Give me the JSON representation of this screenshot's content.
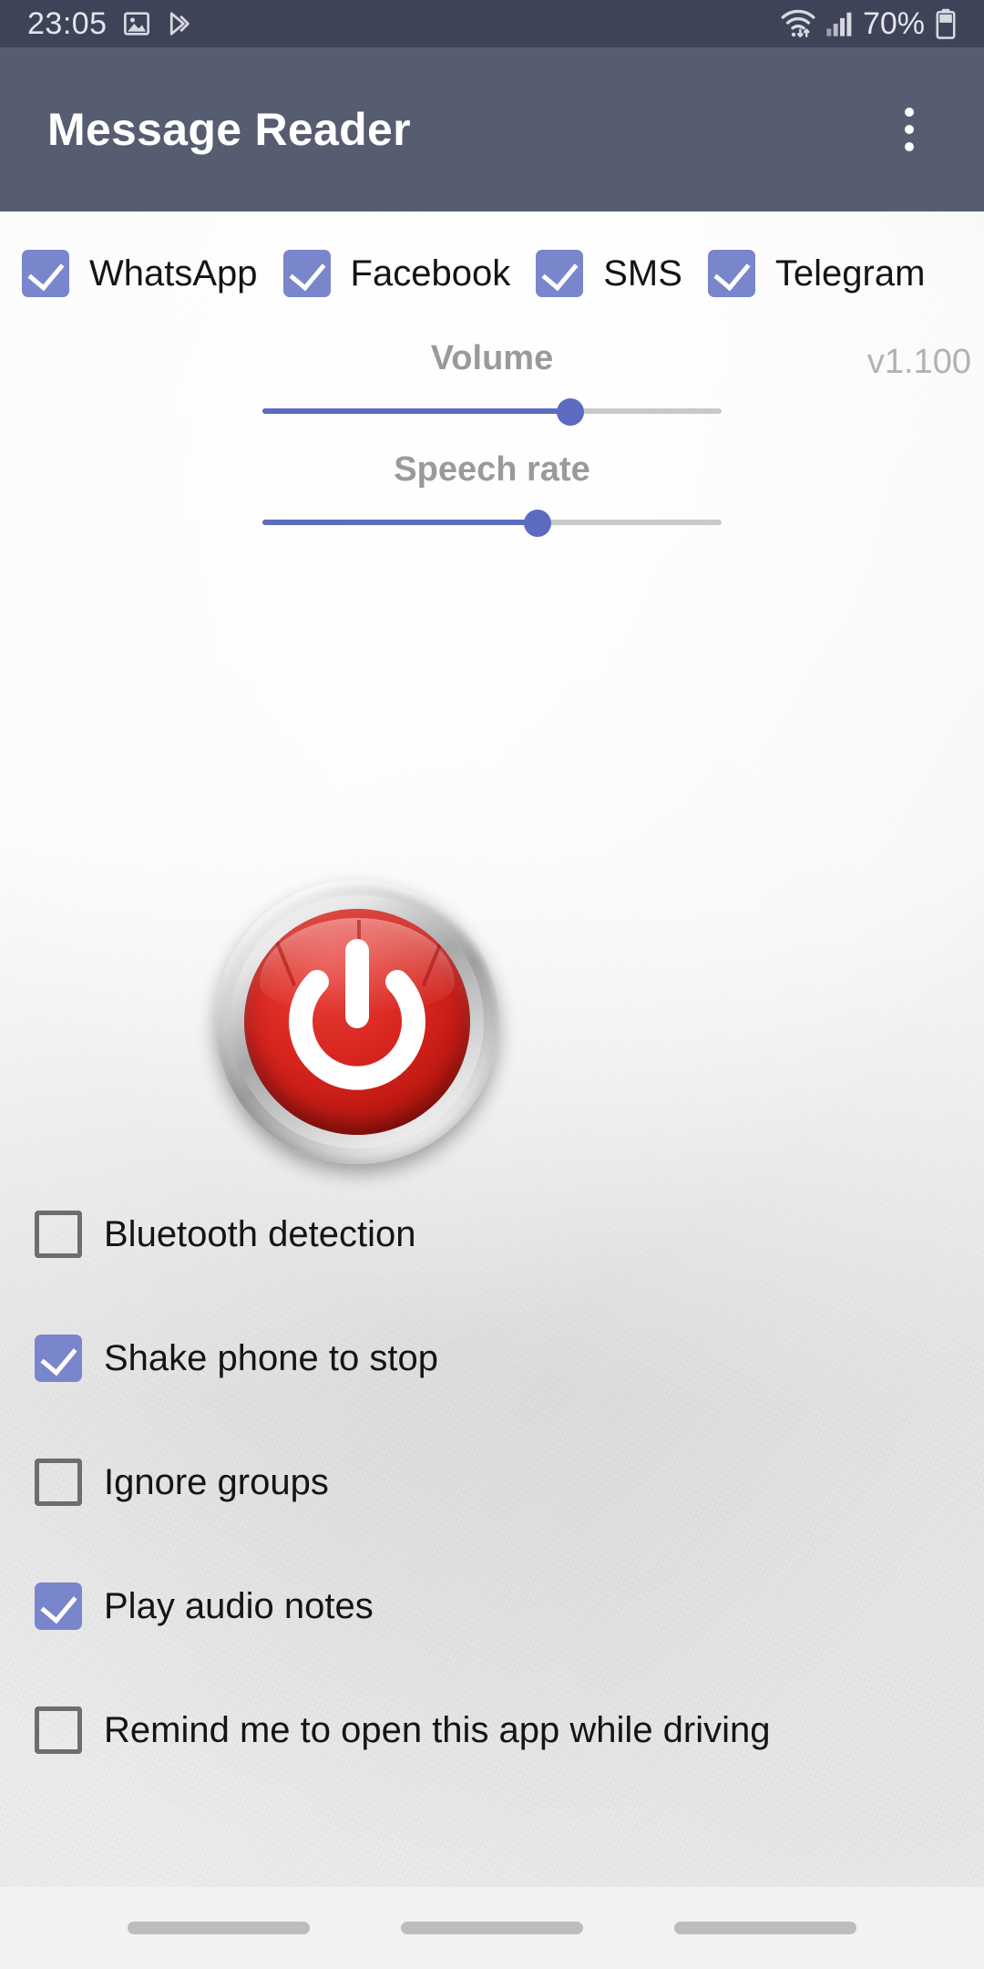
{
  "status_bar": {
    "time": "23:05",
    "battery_percent": "70%",
    "icons": [
      "image-icon",
      "play-triangle-icon",
      "wifi-icon",
      "signal-icon",
      "battery-icon"
    ],
    "background_color": "#3e4358"
  },
  "app_bar": {
    "title": "Message Reader",
    "overflow_menu": "overflow-menu-icon",
    "background_color": "#565d70"
  },
  "sources": {
    "items": [
      {
        "label": "WhatsApp",
        "checked": true
      },
      {
        "label": "Facebook",
        "checked": true
      },
      {
        "label": "SMS",
        "checked": true
      },
      {
        "label": "Telegram",
        "checked": true
      }
    ]
  },
  "sliders": [
    {
      "label": "Volume",
      "value_percent": 67
    },
    {
      "label": "Speech rate",
      "value_percent": 60
    }
  ],
  "version": {
    "text": "v1.100"
  },
  "power_button": {
    "name": "power-toggle-button",
    "state": "off",
    "color": "#d8261f"
  },
  "options": [
    {
      "label": "Bluetooth detection",
      "checked": false
    },
    {
      "label": "Shake phone to stop",
      "checked": true
    },
    {
      "label": "Ignore groups",
      "checked": false
    },
    {
      "label": "Play audio notes",
      "checked": true
    },
    {
      "label": "Remind me to open this app while driving",
      "checked": false
    }
  ],
  "nav_bar": {
    "pills": [
      "recents-pill",
      "home-pill",
      "back-pill"
    ]
  },
  "colors": {
    "accent": "#5c6bc0",
    "checkbox_checked": "#7986cb",
    "label_gray": "#9a9a9a",
    "version_gray": "#b2b2b2"
  }
}
